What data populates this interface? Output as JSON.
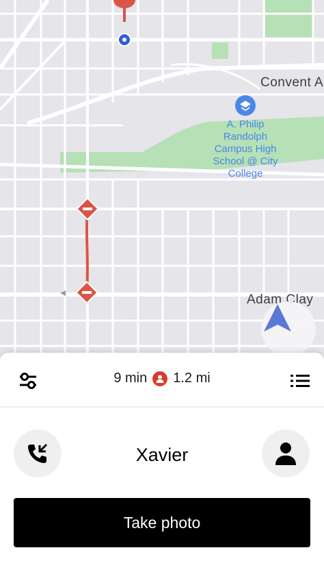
{
  "map": {
    "street_labels": [
      "Convent A",
      "Adam Clay"
    ],
    "poi": {
      "name_lines": [
        "A. Philip",
        "Randolph",
        "Campus High",
        "School @ City",
        "College"
      ],
      "icon": "school-icon"
    },
    "route_color": "#d9554a",
    "pickup_color": "#2e5fd6",
    "park_color": "#b6e0b6",
    "navigation_icon": "navigation-arrow-icon"
  },
  "trip": {
    "duration": "9 min",
    "distance": "1.2 mi",
    "rider_icon": "rider-icon",
    "settings_icon": "sliders-icon",
    "list_icon": "list-icon"
  },
  "rider": {
    "name": "Xavier",
    "call_icon": "phone-call-icon",
    "profile_icon": "person-icon"
  },
  "actions": {
    "primary_label": "Take photo"
  }
}
